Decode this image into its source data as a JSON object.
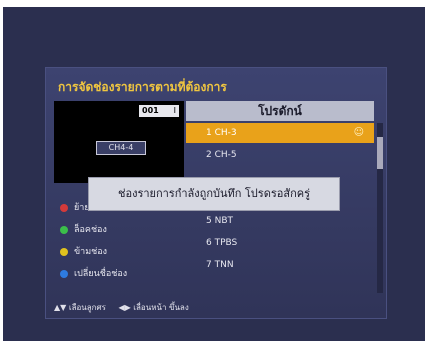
{
  "panel": {
    "title": "การจัดช่องรายการตามที่ต้องการ"
  },
  "preview": {
    "mini_badge_number": "001",
    "mini_badge_suffix": "I",
    "channel_badge": "CH4-4"
  },
  "list": {
    "header": "โปรดักน์",
    "items": [
      {
        "label": "1 CH-3",
        "selected": true,
        "has_icon": true
      },
      {
        "label": "2 CH-5",
        "selected": false
      },
      {
        "label": "",
        "selected": false
      },
      {
        "label": "",
        "selected": false
      },
      {
        "label": "5 NBT",
        "selected": false
      },
      {
        "label": "6 TPBS",
        "selected": false
      },
      {
        "label": "7 TNN",
        "selected": false
      }
    ]
  },
  "menu": {
    "items": [
      {
        "label": "ย้าย",
        "color": "#d43a3a"
      },
      {
        "label": "ล็อคช่อง",
        "color": "#3bbf4a"
      },
      {
        "label": "ข้ามช่อง",
        "color": "#e0c21e"
      },
      {
        "label": "เปลี่ยนชื่อช่อง",
        "color": "#2e7be0"
      }
    ]
  },
  "footer": {
    "hint1": "▲▼ เลือนลูกศร",
    "hint2": "◀▶ เลื่อนหน้า ขึ้นลง"
  },
  "dialog": {
    "message": "ช่องรายการกำลังถูกบันทึก โปรดรอสักครู่"
  },
  "colors": {
    "accent_selected": "#e9a21a",
    "title": "#f0c640"
  }
}
